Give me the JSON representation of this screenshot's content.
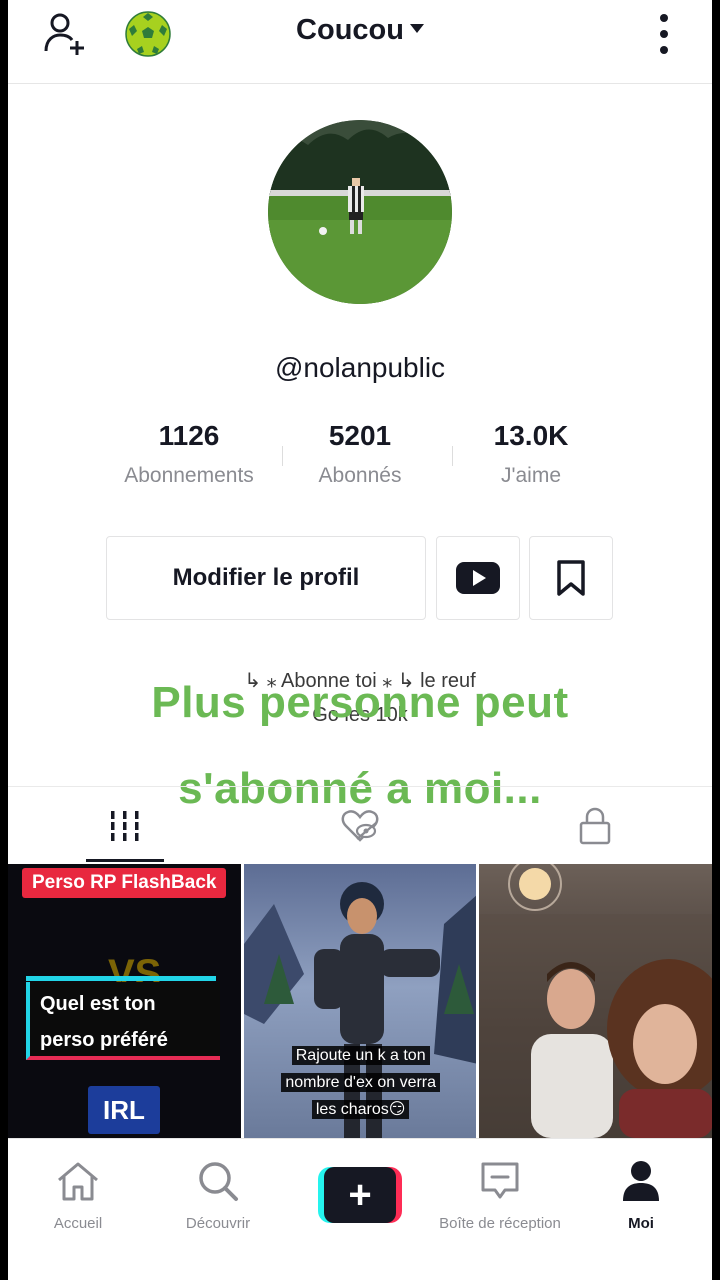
{
  "header": {
    "title": "Coucou",
    "icons": [
      "add-user-icon",
      "soccer-ball-icon",
      "more-vertical-icon"
    ]
  },
  "profile": {
    "username": "@nolanpublic",
    "stats": [
      {
        "value": "1126",
        "label": "Abonnements"
      },
      {
        "value": "5201",
        "label": "Abonnés"
      },
      {
        "value": "13.0K",
        "label": "J'aime"
      }
    ],
    "edit_button": "Modifier le profil",
    "bio_line1": "↳ ⁎ Abonne toi ⁎ ↳ le reuf",
    "bio_line2": "Go les 10k"
  },
  "overlay_text": {
    "line1": "Plus personne peut",
    "line2": "s'abonné a moi..."
  },
  "tabs": [
    "videos-grid-icon",
    "liked-hidden-icon",
    "lock-icon"
  ],
  "videos": [
    {
      "tag": "Perso RP FlashBack",
      "vs": "VS",
      "card_line1": "Quel est ton",
      "card_line2": "perso préféré",
      "badge": "IRL"
    },
    {
      "caption_line1": "Rajoute un k a ton",
      "caption_line2": "nombre d'ex on verra",
      "caption_line3": "les charos😏"
    },
    {}
  ],
  "nav": {
    "home": "Accueil",
    "discover": "Découvrir",
    "inbox": "Boîte de réception",
    "me": "Moi"
  },
  "colors": {
    "overlay_green": "#6bb954",
    "accent_red": "#fe2c55",
    "accent_cyan": "#25f4ee",
    "text_dark": "#161823"
  }
}
